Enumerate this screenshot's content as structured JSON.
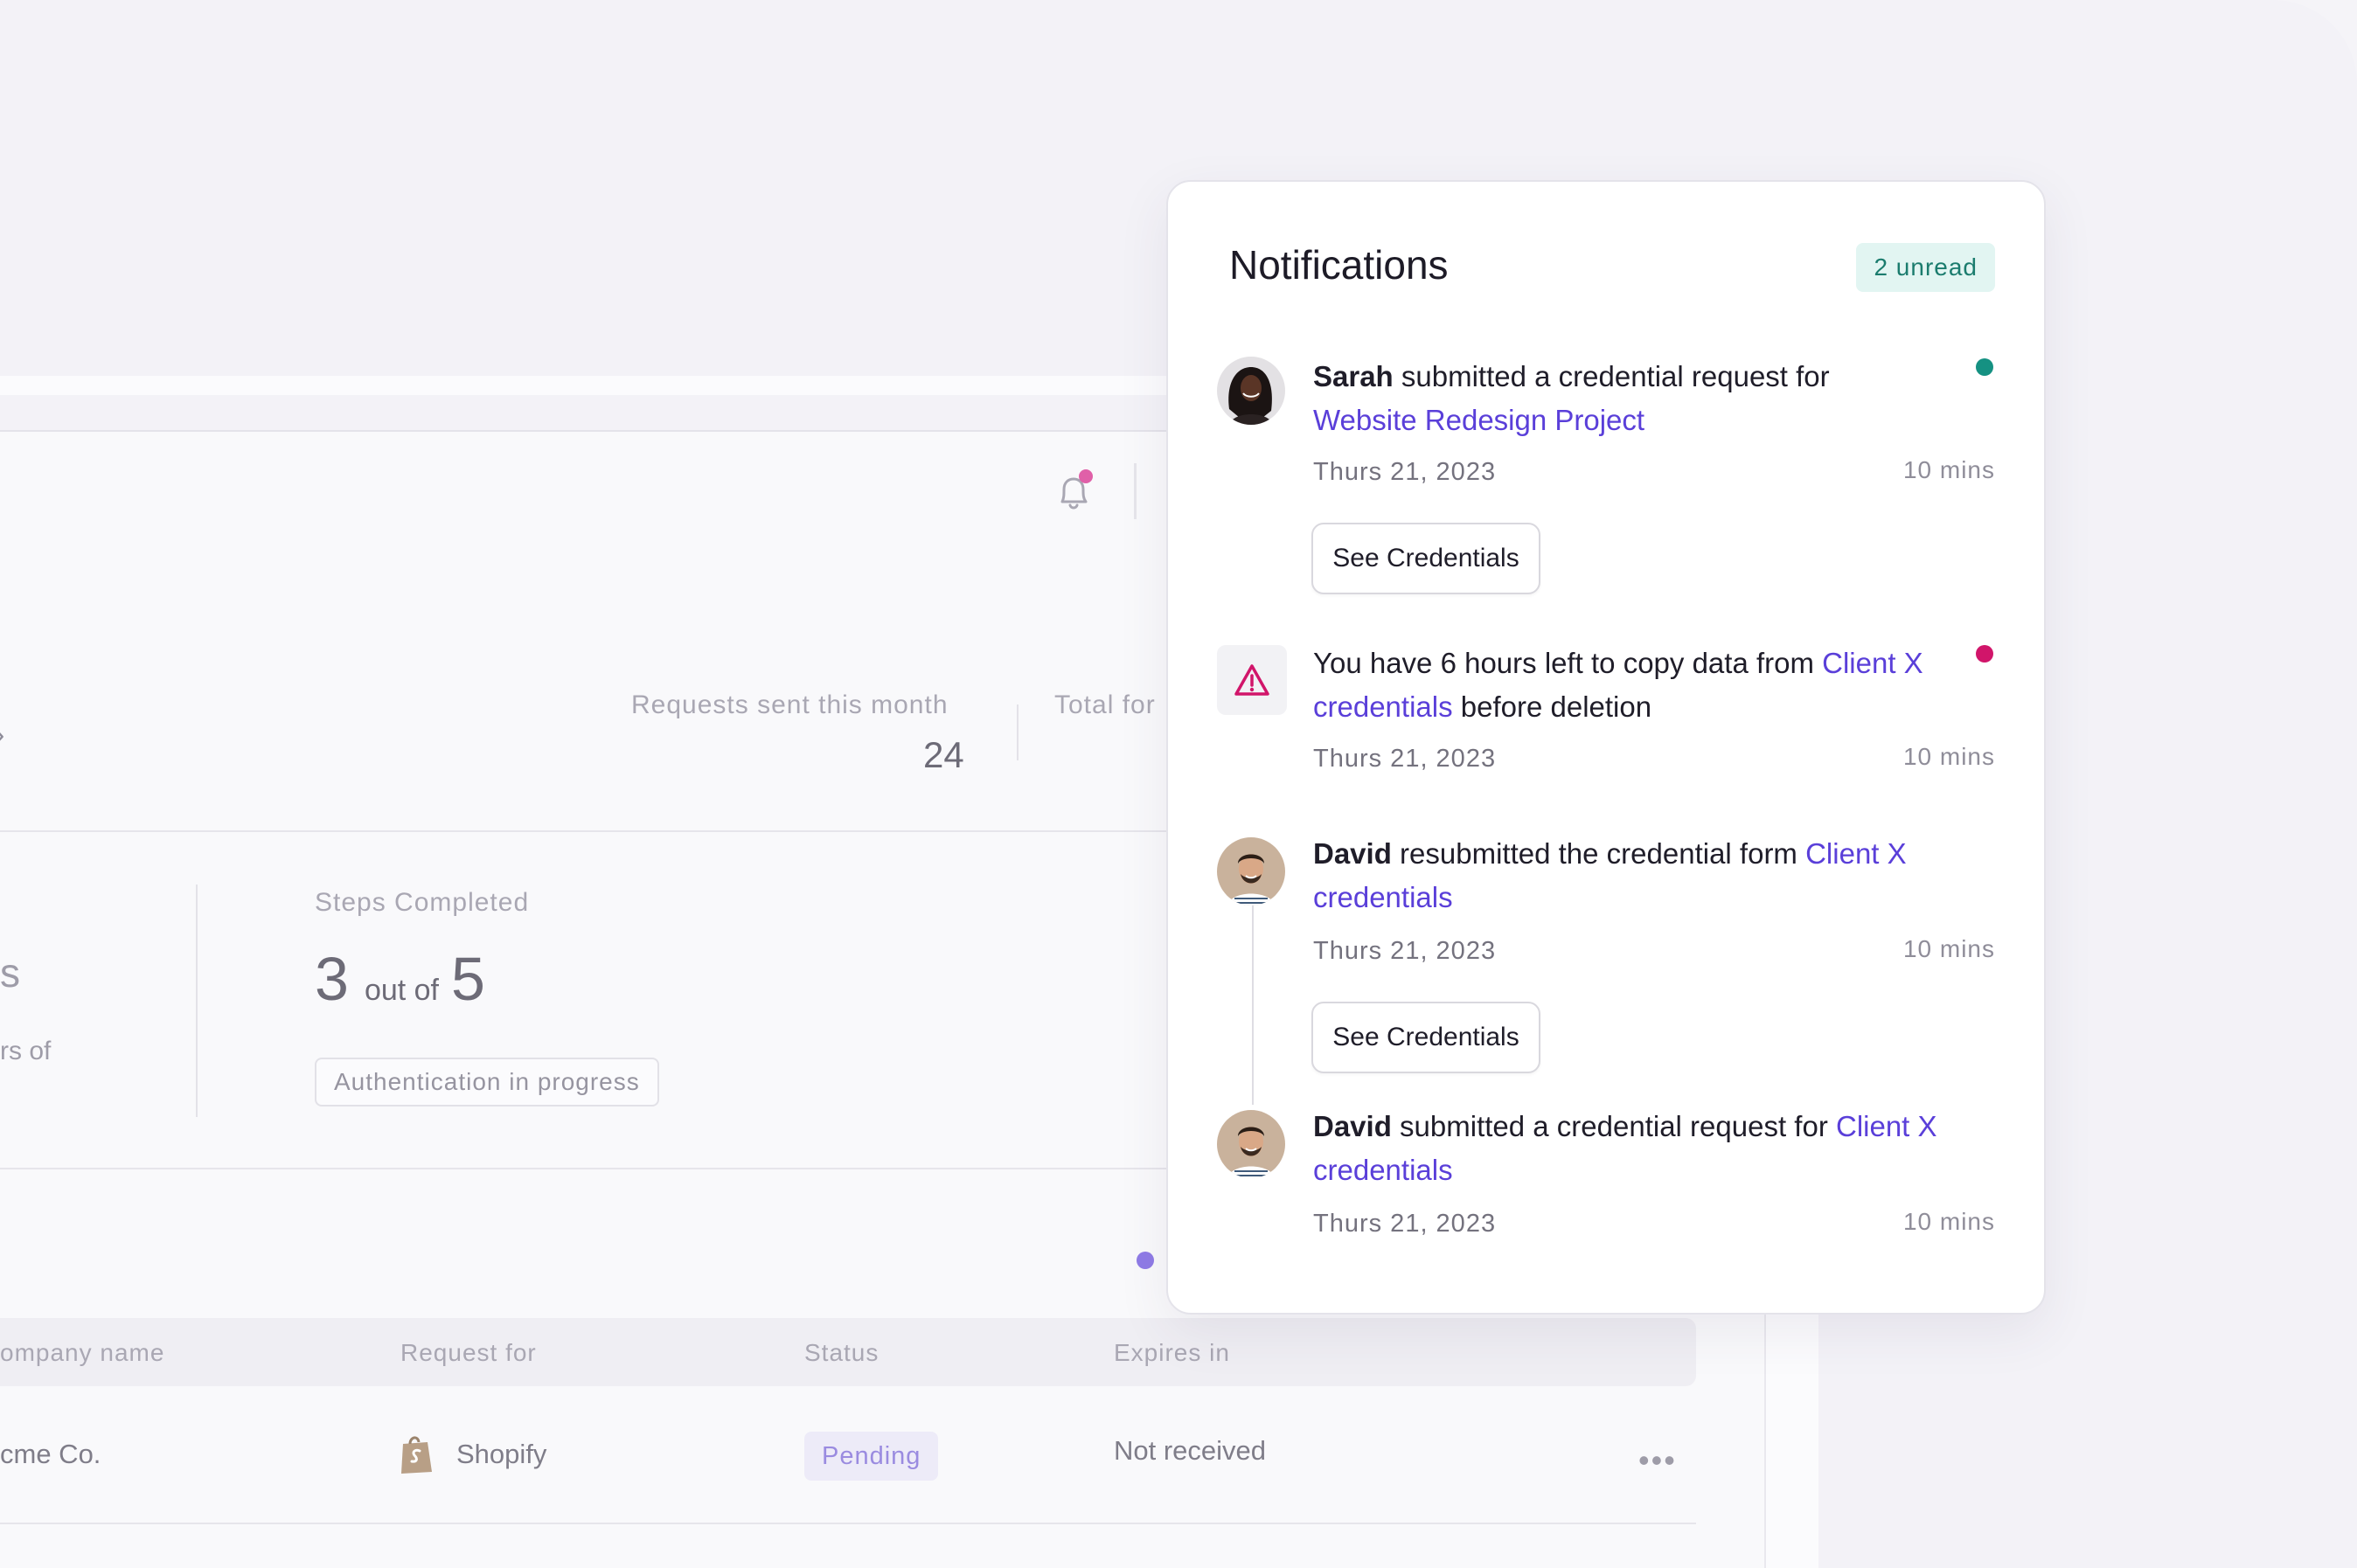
{
  "dashboard": {
    "requests_label": "Requests sent this month",
    "requests_value": "24",
    "total_label": "Total for",
    "left_fragment_1": "s",
    "left_fragment_2": "rs of",
    "steps_label": "Steps Completed",
    "steps_done": "3",
    "steps_out_of": "out of",
    "steps_total": "5",
    "auth_status": "Authentication in progress",
    "table": {
      "headers": [
        "ompany name",
        "Request for",
        "Status",
        "Expires in"
      ],
      "row": {
        "company": "cme Co.",
        "request_for": "Shopify",
        "status": "Pending",
        "expires": "Not received",
        "menu": "•••"
      }
    }
  },
  "notifications": {
    "title": "Notifications",
    "unread_badge": "2 unread",
    "items": [
      {
        "name": "Sarah",
        "text": " submitted a credential request for ",
        "link": "Website Redesign Project",
        "after": "",
        "date": "Thurs 21, 2023",
        "ago": "10 mins",
        "button": "See Credentials",
        "dot_color": "#159182"
      },
      {
        "name": "",
        "text": "You have 6 hours left to copy data from ",
        "link": "Client X credentials",
        "after": " before deletion",
        "date": "Thurs 21, 2023",
        "ago": "10 mins",
        "dot_color": "#d1156a",
        "icon": "warning-icon"
      },
      {
        "name": "David",
        "text": " resubmitted the credential form ",
        "link": "Client X credentials",
        "after": "",
        "date": "Thurs 21, 2023",
        "ago": "10 mins",
        "button": "See Credentials"
      },
      {
        "name": "David",
        "text": " submitted a credential request for ",
        "link": "Client X credentials",
        "after": "",
        "date": "Thurs 21, 2023",
        "ago": "10 mins"
      }
    ]
  },
  "colors": {
    "accent_link": "#5a3fd9",
    "unread_bg": "#e2f5f2",
    "unread_text": "#1b7c6e",
    "bell_badge": "#e060a8",
    "pending_bg": "#edebf8"
  }
}
